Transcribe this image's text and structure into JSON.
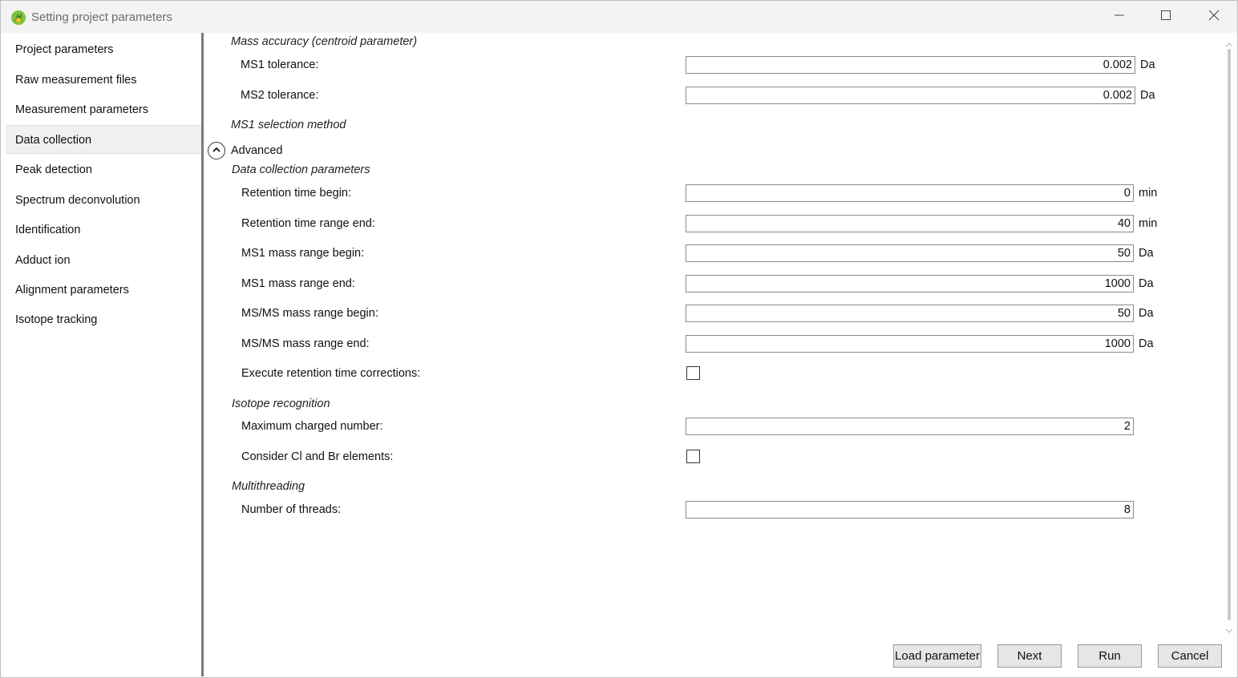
{
  "window": {
    "title": "Setting project parameters",
    "icons": {
      "app": "app-leaf-icon",
      "minimize": "minimize-icon",
      "maximize": "maximize-icon",
      "close": "close-icon"
    }
  },
  "sidebar": {
    "items": [
      {
        "label": "Project parameters"
      },
      {
        "label": "Raw measurement files"
      },
      {
        "label": "Measurement parameters"
      },
      {
        "label": "Data collection",
        "active": true
      },
      {
        "label": "Peak detection"
      },
      {
        "label": "Spectrum deconvolution"
      },
      {
        "label": "Identification"
      },
      {
        "label": "Adduct ion"
      },
      {
        "label": "Alignment parameters"
      },
      {
        "label": "Isotope tracking"
      }
    ]
  },
  "main": {
    "mass_accuracy": {
      "title": "Mass accuracy (centroid parameter)",
      "ms1_label": "MS1 tolerance:",
      "ms1_value": "0.002",
      "ms1_unit": "Da",
      "ms2_label": "MS2 tolerance:",
      "ms2_value": "0.002",
      "ms2_unit": "Da"
    },
    "ms1_selection": {
      "title": "MS1 selection method"
    },
    "advanced": {
      "label": "Advanced",
      "icon": "chevron-up-circle-icon"
    },
    "data_collection": {
      "title": "Data collection parameters",
      "rt_begin_label": "Retention time begin:",
      "rt_begin_value": "0",
      "rt_begin_unit": "min",
      "rt_end_label": "Retention time range end:",
      "rt_end_value": "40",
      "rt_end_unit": "min",
      "ms1_begin_label": "MS1 mass range begin:",
      "ms1_begin_value": "50",
      "ms1_begin_unit": "Da",
      "ms1_end_label": "MS1 mass range end:",
      "ms1_end_value": "1000",
      "ms1_end_unit": "Da",
      "msms_begin_label": "MS/MS mass range begin:",
      "msms_begin_value": "50",
      "msms_begin_unit": "Da",
      "msms_end_label": "MS/MS mass range end:",
      "msms_end_value": "1000",
      "msms_end_unit": "Da",
      "rt_corr_label": "Execute retention time corrections:",
      "rt_corr_checked": false
    },
    "isotope": {
      "title": "Isotope recognition",
      "max_charge_label": "Maximum charged number:",
      "max_charge_value": "2",
      "cl_br_label": "Consider Cl and Br elements:",
      "cl_br_checked": false
    },
    "multithreading": {
      "title": "Multithreading",
      "threads_label": "Number of threads:",
      "threads_value": "8"
    }
  },
  "footer": {
    "load_label": "Load parameter",
    "next_label": "Next",
    "run_label": "Run",
    "cancel_label": "Cancel"
  }
}
